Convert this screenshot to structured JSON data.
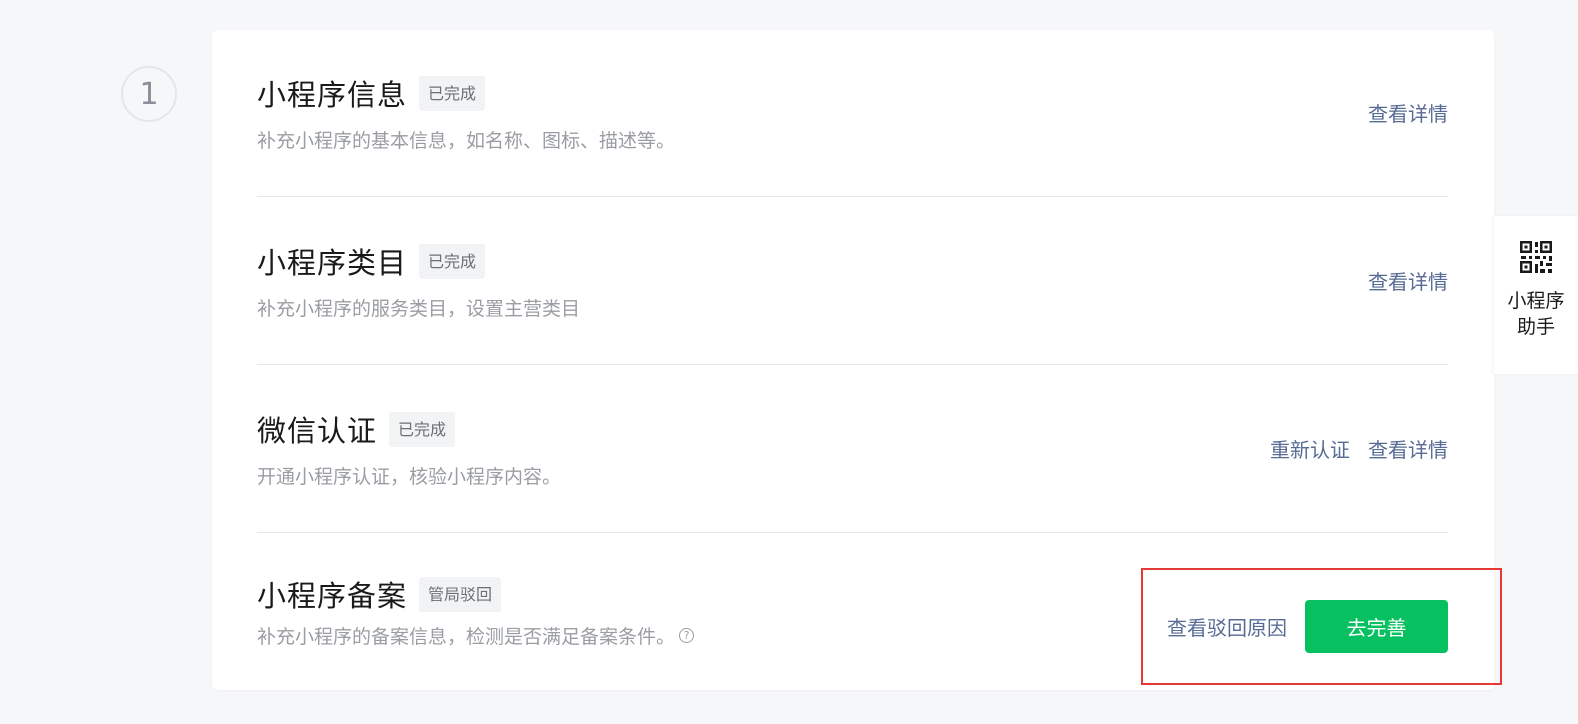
{
  "step": {
    "number": "1"
  },
  "rows": [
    {
      "title": "小程序信息",
      "status": "已完成",
      "description": "补充小程序的基本信息，如名称、图标、描述等。",
      "actions": [
        "查看详情"
      ]
    },
    {
      "title": "小程序类目",
      "status": "已完成",
      "description": "补充小程序的服务类目，设置主营类目",
      "actions": [
        "查看详情"
      ]
    },
    {
      "title": "微信认证",
      "status": "已完成",
      "description": "开通小程序认证，核验小程序内容。",
      "actions": [
        "重新认证",
        "查看详情"
      ]
    },
    {
      "title": "小程序备案",
      "status": "管局驳回",
      "description": "补充小程序的备案信息，检测是否满足备案条件。",
      "help_icon": "help-circle-icon",
      "actions": [
        "查看驳回原因"
      ],
      "primary_action": "去完善"
    }
  ],
  "assistant": {
    "icon": "qr-code-icon",
    "label": "小程序助手"
  },
  "colors": {
    "link": "#576b95",
    "primary": "#07c160",
    "highlight": "#e53935"
  }
}
